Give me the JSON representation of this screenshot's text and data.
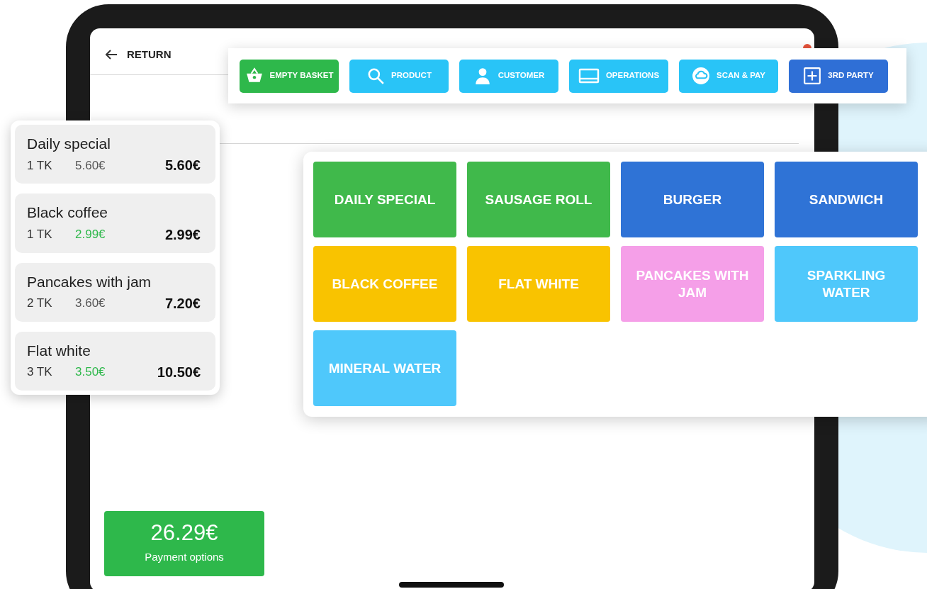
{
  "header": {
    "back_label": "RETURN"
  },
  "toolbar": [
    {
      "label": "EMPTY BASKET",
      "kind": "basket",
      "color": "#2eb84b"
    },
    {
      "label": "PRODUCT",
      "kind": "search",
      "color": "#29c4f7"
    },
    {
      "label": "CUSTOMER",
      "kind": "person",
      "color": "#29c4f7"
    },
    {
      "label": "OPERATIONS",
      "kind": "screen",
      "color": "#29c4f7"
    },
    {
      "label": "SCAN & PAY",
      "kind": "cloud",
      "color": "#29c4f7"
    },
    {
      "label": "3RD PARTY",
      "kind": "plus",
      "color": "#2f6fd6"
    }
  ],
  "order": [
    {
      "name": "Daily special",
      "qty": "1 TK",
      "unit_price": "5.60€",
      "discounted": false,
      "total": "5.60€"
    },
    {
      "name": "Black coffee",
      "qty": "1 TK",
      "unit_price": "2.99€",
      "discounted": true,
      "total": "2.99€"
    },
    {
      "name": "Pancakes with jam",
      "qty": "2 TK",
      "unit_price": "3.60€",
      "discounted": false,
      "total": "7.20€"
    },
    {
      "name": "Flat white",
      "qty": "3 TK",
      "unit_price": "3.50€",
      "discounted": true,
      "total": "10.50€"
    }
  ],
  "products": [
    {
      "label": "DAILY SPECIAL",
      "color": "#40b94b"
    },
    {
      "label": "SAUSAGE ROLL",
      "color": "#40b94b"
    },
    {
      "label": "BURGER",
      "color": "#2f73d6"
    },
    {
      "label": "SANDWICH",
      "color": "#2f73d6"
    },
    {
      "label": "BLACK COFFEE",
      "color": "#f9c300"
    },
    {
      "label": "FLAT WHITE",
      "color": "#f9c300"
    },
    {
      "label": "PANCAKES WITH JAM",
      "color": "#f59fe8"
    },
    {
      "label": "SPARKLING WATER",
      "color": "#4fc8fb"
    },
    {
      "label": "MINERAL WATER",
      "color": "#4fc8fb"
    }
  ],
  "payment": {
    "amount": "26.29€",
    "label": "Payment options"
  }
}
